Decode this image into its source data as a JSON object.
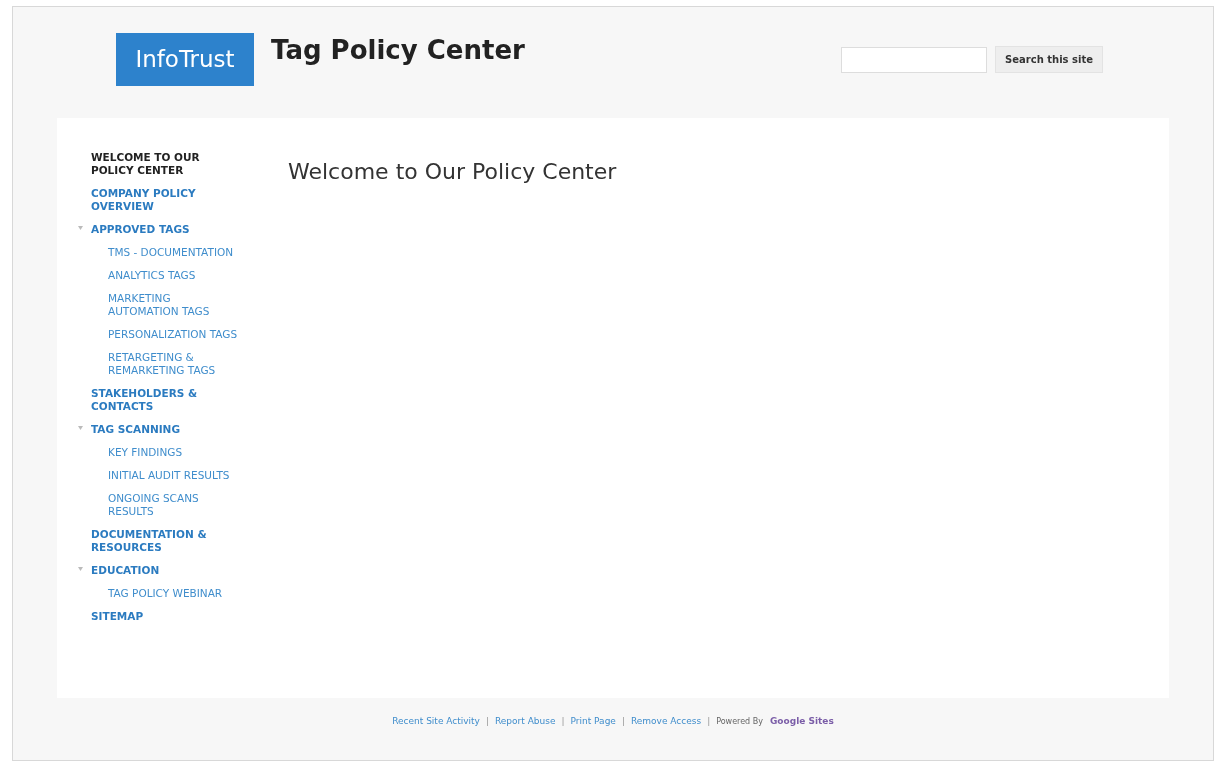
{
  "header": {
    "logo": "InfoTrust",
    "site_title": "Tag Policy Center",
    "search": {
      "button": "Search this site"
    }
  },
  "sidebar": {
    "items": [
      {
        "label": "WELCOME TO OUR POLICY CENTER",
        "selected": true
      },
      {
        "label": "COMPANY POLICY OVERVIEW",
        "selected": false
      },
      {
        "label": "APPROVED TAGS",
        "selected": false,
        "expanded": true,
        "children": [
          {
            "label": "TMS - DOCUMENTATION",
            "selected": false
          },
          {
            "label": "ANALYTICS TAGS",
            "selected": false
          },
          {
            "label": "MARKETING AUTOMATION TAGS",
            "selected": false
          },
          {
            "label": "PERSONALIZATION TAGS",
            "selected": false
          },
          {
            "label": "RETARGETING & REMARKETING TAGS",
            "selected": false
          }
        ]
      },
      {
        "label": "STAKEHOLDERS & CONTACTS",
        "selected": false
      },
      {
        "label": "TAG SCANNING",
        "selected": false,
        "expanded": true,
        "children": [
          {
            "label": "KEY FINDINGS",
            "selected": false
          },
          {
            "label": "INITIAL AUDIT RESULTS",
            "selected": false
          },
          {
            "label": "ONGOING SCANS RESULTS",
            "selected": false
          }
        ]
      },
      {
        "label": "DOCUMENTATION & RESOURCES",
        "selected": false
      },
      {
        "label": "EDUCATION",
        "selected": false,
        "expanded": true,
        "children": [
          {
            "label": "TAG POLICY WEBINAR",
            "selected": false
          }
        ]
      },
      {
        "label": "SITEMAP",
        "selected": false
      }
    ]
  },
  "main": {
    "heading": "Welcome to Our Policy Center"
  },
  "footer": [
    {
      "kind": "link",
      "text": "Recent Site Activity"
    },
    {
      "kind": "separator",
      "text": "|"
    },
    {
      "kind": "link",
      "text": "Report Abuse"
    },
    {
      "kind": "separator",
      "text": "|"
    },
    {
      "kind": "link",
      "text": "Print Page"
    },
    {
      "kind": "separator",
      "text": "|"
    },
    {
      "kind": "link",
      "text": "Remove Access"
    },
    {
      "kind": "separator",
      "text": "|"
    },
    {
      "kind": "text",
      "text": "Powered By"
    },
    {
      "kind": "brand",
      "text": "Google Sites"
    }
  ]
}
